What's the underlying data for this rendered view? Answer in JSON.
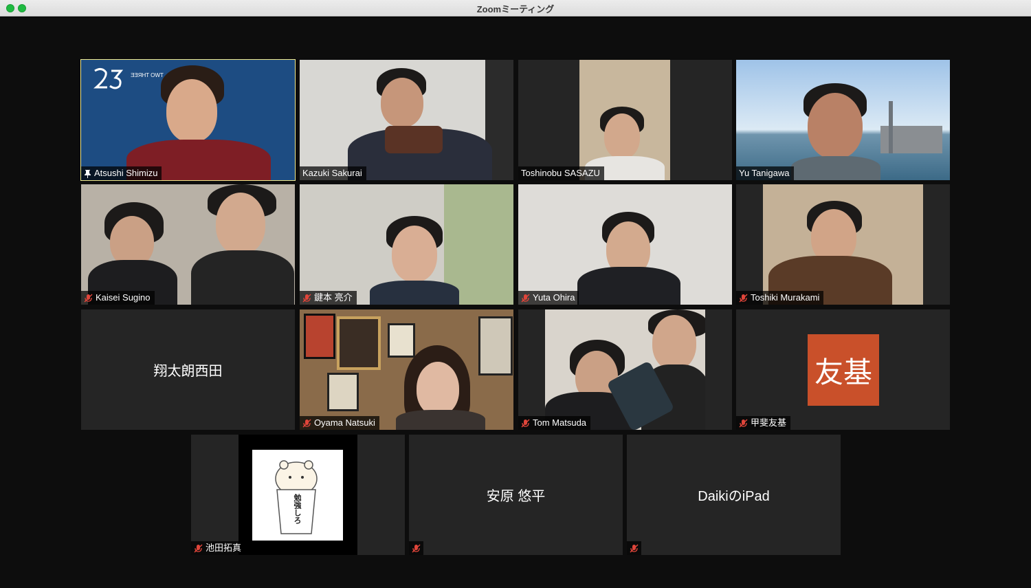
{
  "window": {
    "title": "Zoomミーティング"
  },
  "participants": [
    {
      "name": "Atsushi Shimizu",
      "pinned": true,
      "muted": false,
      "video": true,
      "active_speaker": true,
      "background_text": "TWO THREE"
    },
    {
      "name": "Kazuki Sakurai",
      "muted": false,
      "video": true
    },
    {
      "name": "Toshinobu SASAZU",
      "muted": false,
      "video": true
    },
    {
      "name": "Yu Tanigawa",
      "muted": false,
      "video": true
    },
    {
      "name": "Kaisei Sugino",
      "muted": true,
      "video": true
    },
    {
      "name": "鍵本 亮介",
      "muted": true,
      "video": true
    },
    {
      "name": "Yuta Ohira",
      "muted": true,
      "video": true
    },
    {
      "name": "Toshiki Murakami",
      "muted": true,
      "video": true
    },
    {
      "name": "翔太朗西田",
      "muted": false,
      "video": false
    },
    {
      "name": "Oyama Natsuki",
      "muted": true,
      "video": true
    },
    {
      "name": "Tom Matsuda",
      "muted": true,
      "video": true
    },
    {
      "name": "甲斐友基",
      "muted": true,
      "video": false,
      "avatar_text": "友基",
      "avatar_color": "#c9502a"
    },
    {
      "name": "池田拓真",
      "muted": true,
      "video": true,
      "sticker_text": "勉強しろ"
    },
    {
      "name": "安原 悠平",
      "muted": true,
      "video": false
    },
    {
      "name": "DaikiのiPad",
      "muted": true,
      "video": false
    }
  ],
  "colors": {
    "active_speaker_border": "#f3ec8e",
    "tile_background": "#252525",
    "mute_icon": "#e0453a"
  }
}
